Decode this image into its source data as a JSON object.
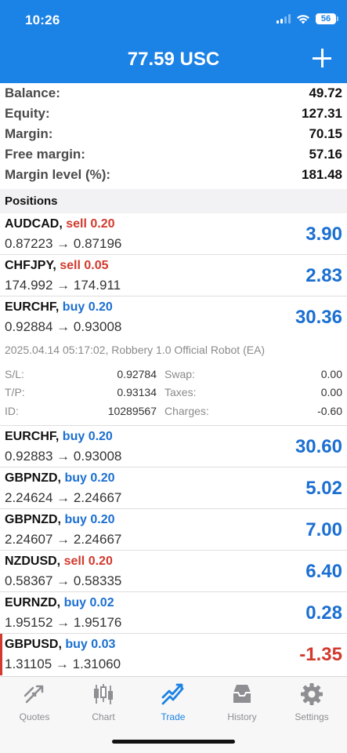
{
  "status": {
    "time": "10:26",
    "battery": "56"
  },
  "header": {
    "title": "77.59 USC"
  },
  "summary": [
    {
      "label": "Balance:",
      "value": "49.72"
    },
    {
      "label": "Equity:",
      "value": "127.31"
    },
    {
      "label": "Margin:",
      "value": "70.15"
    },
    {
      "label": "Free margin:",
      "value": "57.16"
    },
    {
      "label": "Margin level (%):",
      "value": "181.48"
    }
  ],
  "positions_label": "Positions",
  "positions": [
    {
      "symbol": "AUDCAD,",
      "side": "sell 0.20",
      "prices": "0.87223 → 0.87196",
      "profit": "3.90"
    },
    {
      "symbol": "CHFJPY,",
      "side": "sell 0.05",
      "prices": "174.992 → 174.911",
      "profit": "2.83"
    },
    {
      "symbol": "EURCHF,",
      "side": "buy 0.20",
      "prices": "0.92884 → 0.93008",
      "profit": "30.36"
    },
    {
      "symbol": "EURCHF,",
      "side": "buy 0.20",
      "prices": "0.92883 → 0.93008",
      "profit": "30.60"
    },
    {
      "symbol": "GBPNZD,",
      "side": "buy 0.20",
      "prices": "2.24624 → 2.24667",
      "profit": "5.02"
    },
    {
      "symbol": "GBPNZD,",
      "side": "buy 0.20",
      "prices": "2.24607 → 2.24667",
      "profit": "7.00"
    },
    {
      "symbol": "NZDUSD,",
      "side": "sell 0.20",
      "prices": "0.58367 → 0.58335",
      "profit": "6.40"
    },
    {
      "symbol": "EURNZD,",
      "side": "buy 0.02",
      "prices": "1.95152 → 1.95176",
      "profit": "0.28"
    },
    {
      "symbol": "GBPUSD,",
      "side": "buy 0.03",
      "prices": "1.31105 → 1.31060",
      "profit": "-1.35"
    }
  ],
  "expanded": {
    "comment": "2025.04.14 05:17:02, Robbery 1.0 Official Robot (EA)",
    "sl_label": "S/L:",
    "sl": "0.92784",
    "tp_label": "T/P:",
    "tp": "0.93134",
    "id_label": "ID:",
    "id": "10289567",
    "swap_label": "Swap:",
    "swap": "0.00",
    "taxes_label": "Taxes:",
    "taxes": "0.00",
    "charges_label": "Charges:",
    "charges": "-0.60"
  },
  "tabs": [
    {
      "label": "Quotes",
      "icon": "quotes-icon"
    },
    {
      "label": "Chart",
      "icon": "chart-icon"
    },
    {
      "label": "Trade",
      "icon": "trade-icon"
    },
    {
      "label": "History",
      "icon": "history-icon"
    },
    {
      "label": "Settings",
      "icon": "settings-icon"
    }
  ],
  "colors": {
    "header": "#1b82e6",
    "buy": "#1b6fd1",
    "sell": "#d23a2e",
    "tab_active": "#1b82e6"
  }
}
